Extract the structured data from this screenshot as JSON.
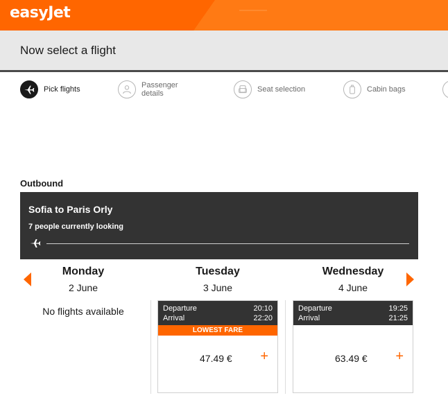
{
  "brand": {
    "name": "easyJet"
  },
  "header": {
    "title": "Now select a flight"
  },
  "steps": [
    {
      "label": "Pick flights",
      "icon": "plane-icon",
      "active": true
    },
    {
      "label_line1": "Passenger",
      "label_line2": "details",
      "icon": "passenger-icon",
      "active": false
    },
    {
      "label": "Seat selection",
      "icon": "seat-icon",
      "active": false
    },
    {
      "label": "Cabin bags",
      "icon": "cabin-bag-icon",
      "active": false
    }
  ],
  "outbound": {
    "section_title": "Outbound",
    "route": "Sofia to Paris Orly",
    "looking": "7 people currently looking"
  },
  "days": [
    {
      "name": "Monday",
      "date": "2 June",
      "message": "No flights available"
    },
    {
      "name": "Tuesday",
      "date": "3 June"
    },
    {
      "name": "Wednesday",
      "date": "4 June"
    }
  ],
  "flights": [
    {
      "departure_label": "Departure",
      "departure_time": "20:10",
      "arrival_label": "Arrival",
      "arrival_time": "22:20",
      "badge": "LOWEST FARE",
      "price": "47.49 €",
      "add": "+"
    },
    {
      "departure_label": "Departure",
      "departure_time": "19:25",
      "arrival_label": "Arrival",
      "arrival_time": "21:25",
      "price": "63.49 €",
      "add": "+"
    }
  ],
  "colors": {
    "brand_orange": "#ff6600",
    "dark_panel": "#333333",
    "heading_bar": "#e8e8e8"
  }
}
